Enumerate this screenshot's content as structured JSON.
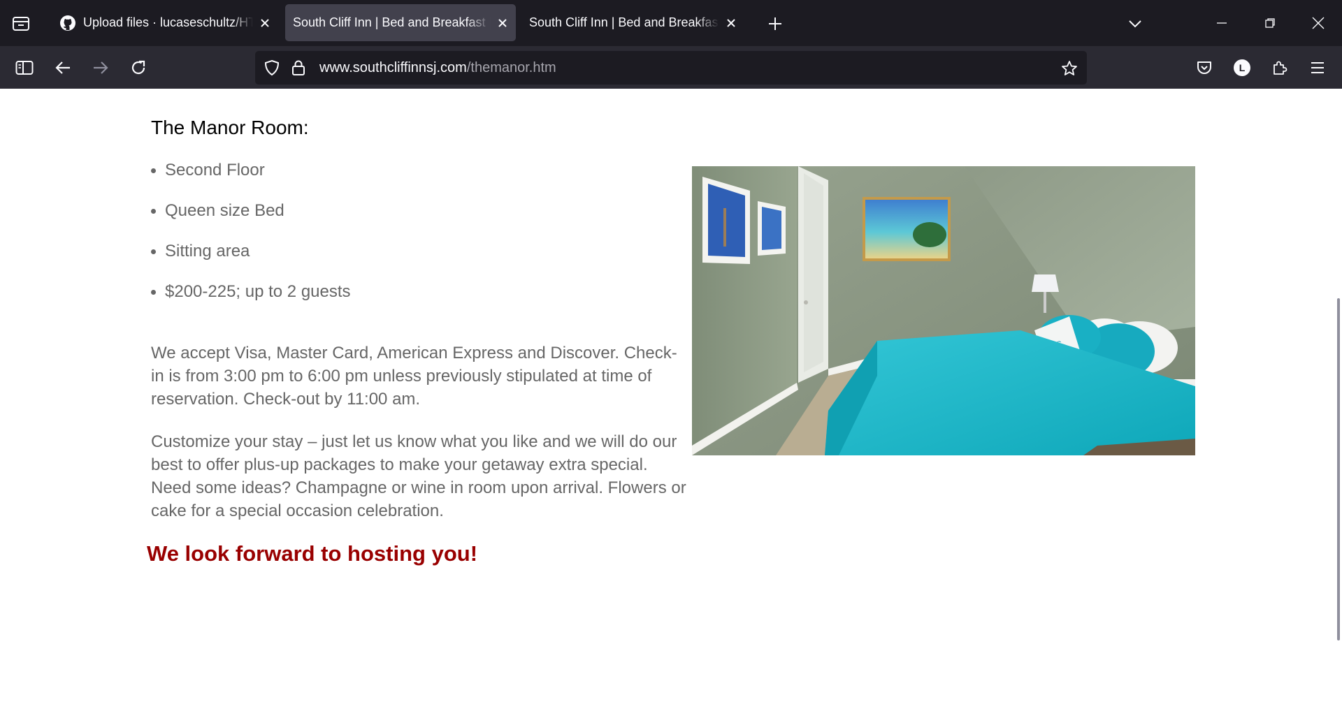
{
  "browser": {
    "tabs": [
      {
        "title": "Upload files · lucaseschultz/HTML",
        "active": false,
        "favicon": "github-icon"
      },
      {
        "title": "South Cliff Inn | Bed and Breakfast |",
        "active": true,
        "favicon": "none"
      },
      {
        "title": "South Cliff Inn | Bed and Breakfast |",
        "active": false,
        "favicon": "none"
      }
    ],
    "url_domain": "www.southcliffinnsj.com",
    "url_path": "/themanor.htm",
    "profile_initial": "L"
  },
  "page": {
    "room_title": "The Manor Room:",
    "features": [
      "Second Floor",
      "Queen size Bed",
      "Sitting area",
      "$200-225; up to 2 guests"
    ],
    "payment_paragraph": "We accept Visa, Master Card, American Express and Discover. Check-in is from 3:00 pm to 6:00 pm unless previously stipulated at time of reservation. Check-out by 11:00 am.",
    "customize_paragraph": "Customize your stay – just let us know what you like and we will do our best to offer plus-up packages to make your getaway extra special. Need some ideas? Champagne or wine in room upon arrival. Flowers or cake for a special occasion celebration.",
    "closing": "We look forward to hosting you!"
  },
  "colors": {
    "chrome_dark": "#1c1b22",
    "chrome_toolbar": "#2b2a33",
    "active_tab": "#42414d",
    "body_text": "#666666",
    "closing_text": "#990000",
    "bed_teal": "#1fb8c8"
  }
}
